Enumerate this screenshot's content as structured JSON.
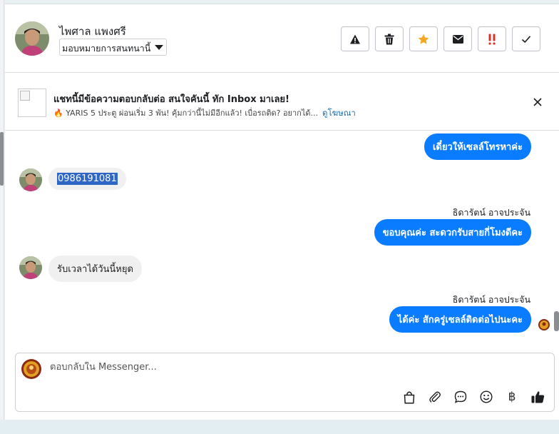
{
  "header": {
    "contact_name": "ไพศาล แพงศรี",
    "assign_label": "มอบหมายการสนทนานี้",
    "actions": [
      {
        "name": "spam-alert-icon"
      },
      {
        "name": "trash-icon"
      },
      {
        "name": "star-icon",
        "color": "#f5a623"
      },
      {
        "name": "mail-icon"
      },
      {
        "name": "urgent-icon",
        "color": "#d93025"
      },
      {
        "name": "check-icon"
      }
    ]
  },
  "ad": {
    "title": "แชทนี้มีข้อความตอบกลับต่อ สนใจคันนี้ ทัก Inbox มาเลย!",
    "subtitle": "🔥 YARIS 5 ประตู ผ่อนเริ่ม 3 พัน! คุ้มกว่านี้ไม่มีอีกแล้ว! เบื่อรถติด? อยากได้...",
    "link": "ดูโฆษณา"
  },
  "messages": [
    {
      "dir": "out",
      "text": "เดี๋ยวให้เซลล์โทรหาค่ะ"
    },
    {
      "dir": "in",
      "text": "0986191081"
    },
    {
      "dir": "out",
      "sender": "ธิดารัตน์ อาจประจัน",
      "text": "ขอบคุณค่ะ สะดวกรับสายกี่โมงดีคะ"
    },
    {
      "dir": "in",
      "text": "รับเวลาได้วันนี้หยุด"
    },
    {
      "dir": "out",
      "sender": "ธิดารัตน์ อาจประจัน",
      "text": "ได้ค่ะ สักครู่เซลล์ติดต่อไปนะคะ"
    }
  ],
  "composer": {
    "placeholder": "ตอบกลับใน Messenger...",
    "tools": [
      "bag-icon",
      "paperclip-icon",
      "saved-reply-icon",
      "emoji-icon",
      "baht-icon",
      "thumbs-up-icon"
    ],
    "baht_symbol": "฿"
  },
  "colors": {
    "accent": "#0a7cff",
    "link": "#1b6fb0"
  }
}
